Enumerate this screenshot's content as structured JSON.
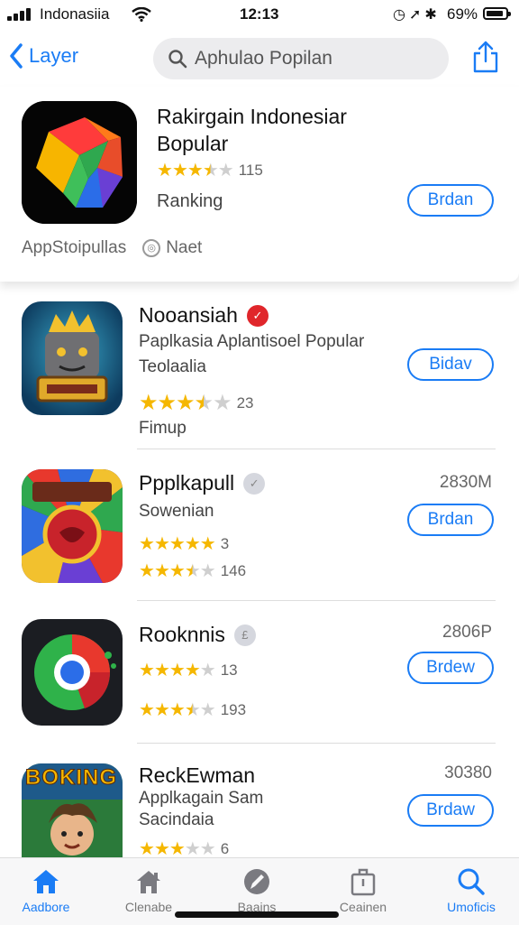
{
  "status_bar": {
    "carrier": "Indonasiia",
    "time": "12:13",
    "battery": "69%"
  },
  "nav": {
    "back_label": "Layer",
    "search_placeholder": "Aphulao Popilan"
  },
  "featured": {
    "title": "Rakirgain Indonesiar Bopular",
    "rating": 3.5,
    "rating_count": "115",
    "subtitle": "Ranking",
    "get_label": "Brdan",
    "meta_left": "AppStoipullas",
    "meta_badge": "Naet"
  },
  "apps": [
    {
      "name": "Nooansiah",
      "line1": "Paplkasia Aplantisoel Popular",
      "line2": "Teolaalia",
      "rating": 3.5,
      "rating_count": "23",
      "line3": "Fimup",
      "get_label": "Bidav",
      "size": "",
      "badge_color": "#e0262b"
    },
    {
      "name": "Ppplkapull",
      "line1": "Sowenian",
      "rating": 5,
      "rating_count": "3",
      "rating2": 3.5,
      "rating2_count": "146",
      "get_label": "Brdan",
      "size": "2830M",
      "badge_color": "#c9cbd4"
    },
    {
      "name": "Rooknnis",
      "rating": 4,
      "rating_count": "13",
      "rating2": 3.5,
      "rating2_count": "193",
      "get_label": "Brdew",
      "size": "2806P",
      "badge_color": "#c9cbd4"
    },
    {
      "name": "ReckEwman",
      "line1": "Applkagain Sam",
      "line2": "Sacindaia",
      "rating": 3,
      "rating_count": "6",
      "get_label": "Brdaw",
      "size": "30380",
      "icon_text": "BOKING"
    }
  ],
  "tabs": [
    {
      "label": "Aadbore",
      "icon": "home-icon",
      "active": true
    },
    {
      "label": "Clenabe",
      "icon": "house-outline-icon",
      "active": false
    },
    {
      "label": "Baains",
      "icon": "pen-icon",
      "active": false
    },
    {
      "label": "Ceainen",
      "icon": "box-icon",
      "active": false
    },
    {
      "label": "Umoficis",
      "icon": "search-icon",
      "active": false
    }
  ],
  "colors": {
    "accent": "#1a7cf5",
    "star": "#f5b700"
  }
}
